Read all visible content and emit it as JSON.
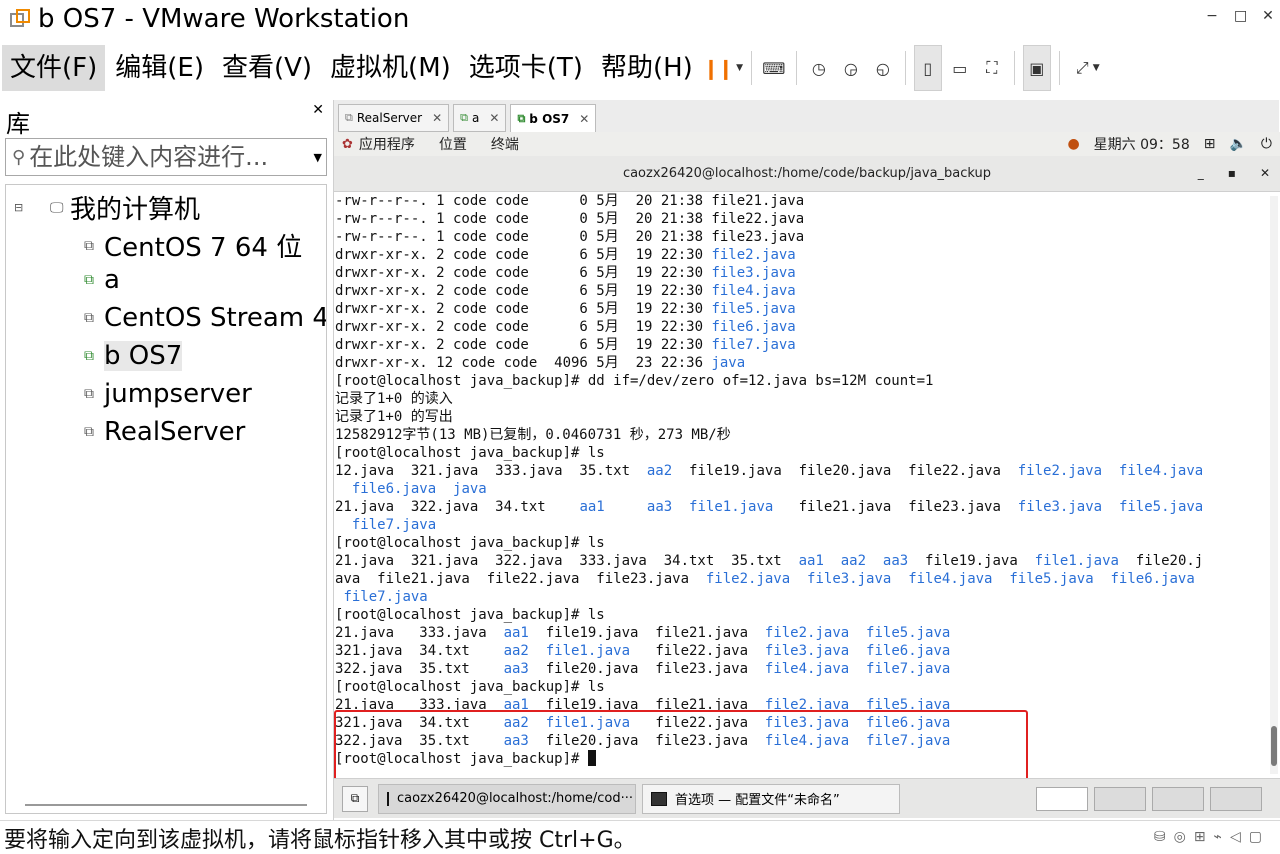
{
  "window": {
    "title": "b OS7 - VMware Workstation"
  },
  "menu": {
    "file": "文件(F)",
    "edit": "编辑(E)",
    "view": "查看(V)",
    "vm": "虚拟机(M)",
    "tabs": "选项卡(T)",
    "help": "帮助(H)"
  },
  "library": {
    "title": "库",
    "search_placeholder": "在此处键入内容进行...",
    "root": "我的计算机",
    "vms": [
      "CentOS 7 64 位",
      "a",
      "CentOS Stream 4",
      "b OS7",
      "jumpserver",
      "RealServer"
    ]
  },
  "tabs": [
    {
      "label": "RealServer",
      "active": false
    },
    {
      "label": "a",
      "active": false
    },
    {
      "label": "b OS7",
      "active": true
    }
  ],
  "guest_panel": {
    "applications": "应用程序",
    "places": "位置",
    "terminal": "终端",
    "clock": "星期六 09：58"
  },
  "terminal": {
    "title": "caozx26420@localhost:/home/code/backup/java_backup",
    "lines": [
      [
        {
          "t": "-rw-r--r--. 1 code code      0 5月  20 21:38 file21.java"
        }
      ],
      [
        {
          "t": "-rw-r--r--. 1 code code      0 5月  20 21:38 file22.java"
        }
      ],
      [
        {
          "t": "-rw-r--r--. 1 code code      0 5月  20 21:38 file23.java"
        }
      ],
      [
        {
          "t": "drwxr-xr-x. 2 code code      6 5月  19 22:30 "
        },
        {
          "t": "file2.java",
          "b": true
        }
      ],
      [
        {
          "t": "drwxr-xr-x. 2 code code      6 5月  19 22:30 "
        },
        {
          "t": "file3.java",
          "b": true
        }
      ],
      [
        {
          "t": "drwxr-xr-x. 2 code code      6 5月  19 22:30 "
        },
        {
          "t": "file4.java",
          "b": true
        }
      ],
      [
        {
          "t": "drwxr-xr-x. 2 code code      6 5月  19 22:30 "
        },
        {
          "t": "file5.java",
          "b": true
        }
      ],
      [
        {
          "t": "drwxr-xr-x. 2 code code      6 5月  19 22:30 "
        },
        {
          "t": "file6.java",
          "b": true
        }
      ],
      [
        {
          "t": "drwxr-xr-x. 2 code code      6 5月  19 22:30 "
        },
        {
          "t": "file7.java",
          "b": true
        }
      ],
      [
        {
          "t": "drwxr-xr-x. 12 code code  4096 5月  23 22:36 "
        },
        {
          "t": "java",
          "b": true
        }
      ],
      [
        {
          "t": "[root@localhost java_backup]# dd if=/dev/zero of=12.java bs=12M count=1"
        }
      ],
      [
        {
          "t": "记录了1+0 的读入"
        }
      ],
      [
        {
          "t": "记录了1+0 的写出"
        }
      ],
      [
        {
          "t": "12582912字节(13 MB)已复制，0.0460731 秒，273 MB/秒"
        }
      ],
      [
        {
          "t": "[root@localhost java_backup]# ls"
        }
      ],
      [
        {
          "t": "12.java  321.java  333.java  35.txt  "
        },
        {
          "t": "aa2",
          "b": true
        },
        {
          "t": "  file19.java  file20.java  file22.java  "
        },
        {
          "t": "file2.java",
          "b": true
        },
        {
          "t": "  "
        },
        {
          "t": "file4.java",
          "b": true
        }
      ],
      [
        {
          "t": "  "
        },
        {
          "t": "file6.java",
          "b": true
        },
        {
          "t": "  "
        },
        {
          "t": "java",
          "b": true
        }
      ],
      [
        {
          "t": "21.java  322.java  34.txt    "
        },
        {
          "t": "aa1",
          "b": true
        },
        {
          "t": "     "
        },
        {
          "t": "aa3",
          "b": true
        },
        {
          "t": "  "
        },
        {
          "t": "file1.java",
          "b": true
        },
        {
          "t": "   file21.java  file23.java  "
        },
        {
          "t": "file3.java",
          "b": true
        },
        {
          "t": "  "
        },
        {
          "t": "file5.java",
          "b": true
        }
      ],
      [
        {
          "t": "  "
        },
        {
          "t": "file7.java",
          "b": true
        }
      ],
      [
        {
          "t": "[root@localhost java_backup]# ls"
        }
      ],
      [
        {
          "t": "21.java  321.java  322.java  333.java  34.txt  35.txt  "
        },
        {
          "t": "aa1",
          "b": true
        },
        {
          "t": "  "
        },
        {
          "t": "aa2",
          "b": true
        },
        {
          "t": "  "
        },
        {
          "t": "aa3",
          "b": true
        },
        {
          "t": "  file19.java  "
        },
        {
          "t": "file1.java",
          "b": true
        },
        {
          "t": "  file20.j"
        }
      ],
      [
        {
          "t": "ava  file21.java  file22.java  file23.java  "
        },
        {
          "t": "file2.java",
          "b": true
        },
        {
          "t": "  "
        },
        {
          "t": "file3.java",
          "b": true
        },
        {
          "t": "  "
        },
        {
          "t": "file4.java",
          "b": true
        },
        {
          "t": "  "
        },
        {
          "t": "file5.java",
          "b": true
        },
        {
          "t": "  "
        },
        {
          "t": "file6.java",
          "b": true
        }
      ],
      [
        {
          "t": " "
        },
        {
          "t": "file7.java",
          "b": true
        }
      ],
      [
        {
          "t": "[root@localhost java_backup]# ls"
        }
      ],
      [
        {
          "t": "21.java   333.java  "
        },
        {
          "t": "aa1",
          "b": true
        },
        {
          "t": "  file19.java  file21.java  "
        },
        {
          "t": "file2.java",
          "b": true
        },
        {
          "t": "  "
        },
        {
          "t": "file5.java",
          "b": true
        }
      ],
      [
        {
          "t": "321.java  34.txt    "
        },
        {
          "t": "aa2",
          "b": true
        },
        {
          "t": "  "
        },
        {
          "t": "file1.java",
          "b": true
        },
        {
          "t": "   file22.java  "
        },
        {
          "t": "file3.java",
          "b": true
        },
        {
          "t": "  "
        },
        {
          "t": "file6.java",
          "b": true
        }
      ],
      [
        {
          "t": "322.java  35.txt    "
        },
        {
          "t": "aa3",
          "b": true
        },
        {
          "t": "  file20.java  file23.java  "
        },
        {
          "t": "file4.java",
          "b": true
        },
        {
          "t": "  "
        },
        {
          "t": "file7.java",
          "b": true
        }
      ],
      [
        {
          "t": "[root@localhost java_backup]# ls"
        }
      ],
      [
        {
          "t": "21.java   333.java  "
        },
        {
          "t": "aa1",
          "b": true
        },
        {
          "t": "  file19.java  file21.java  "
        },
        {
          "t": "file2.java",
          "b": true
        },
        {
          "t": "  "
        },
        {
          "t": "file5.java",
          "b": true
        }
      ],
      [
        {
          "t": "321.java  34.txt    "
        },
        {
          "t": "aa2",
          "b": true
        },
        {
          "t": "  "
        },
        {
          "t": "file1.java",
          "b": true
        },
        {
          "t": "   file22.java  "
        },
        {
          "t": "file3.java",
          "b": true
        },
        {
          "t": "  "
        },
        {
          "t": "file6.java",
          "b": true
        }
      ],
      [
        {
          "t": "322.java  35.txt    "
        },
        {
          "t": "aa3",
          "b": true
        },
        {
          "t": "  file20.java  file23.java  "
        },
        {
          "t": "file4.java",
          "b": true
        },
        {
          "t": "  "
        },
        {
          "t": "file7.java",
          "b": true
        }
      ],
      [
        {
          "t": "[root@localhost java_backup]# "
        }
      ]
    ]
  },
  "taskbar": {
    "items": [
      "caozx26420@localhost:/home/cod···",
      "首选项 — 配置文件“未命名”"
    ]
  },
  "statusbar": {
    "message": "要将输入定向到该虚拟机，请将鼠标指针移入其中或按 Ctrl+G。"
  },
  "colors": {
    "accent_orange": "#f07000",
    "link_blue": "#2a6fd6",
    "highlight_red": "#e02020"
  }
}
